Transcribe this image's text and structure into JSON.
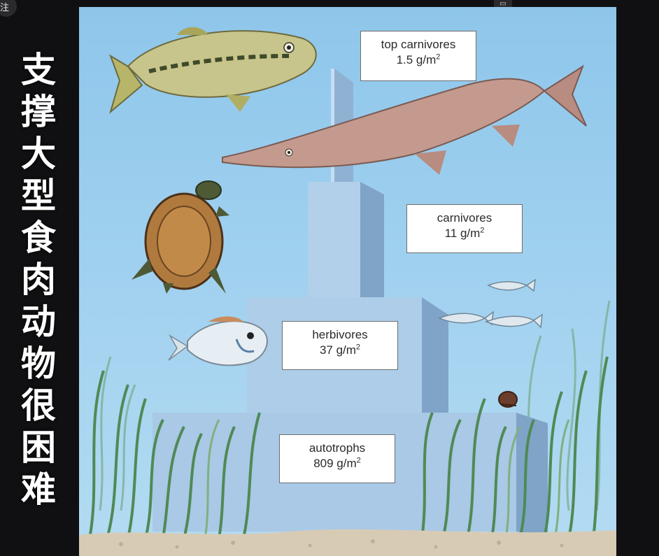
{
  "page": {
    "badge_text": "注",
    "side_title_chars": [
      "支",
      "撑",
      "大",
      "型",
      "食",
      "肉",
      "动",
      "物",
      "很",
      "困",
      "难"
    ]
  },
  "pyramid": {
    "levels": [
      {
        "name": "top carnivores",
        "value": "1.5 g/m",
        "unit_exponent": "2"
      },
      {
        "name": "carnivores",
        "value": "11 g/m",
        "unit_exponent": "2"
      },
      {
        "name": "herbivores",
        "value": "37 g/m",
        "unit_exponent": "2"
      },
      {
        "name": "autotrophs",
        "value": "809 g/m",
        "unit_exponent": "2"
      }
    ]
  },
  "colors": {
    "water": "#9fd0ef",
    "block_front": "#a9c9e6",
    "block_side": "#7fa4c8",
    "block_top": "#c6ddf1",
    "sand": "#d8cbb5",
    "grass": "#4f8a55"
  }
}
